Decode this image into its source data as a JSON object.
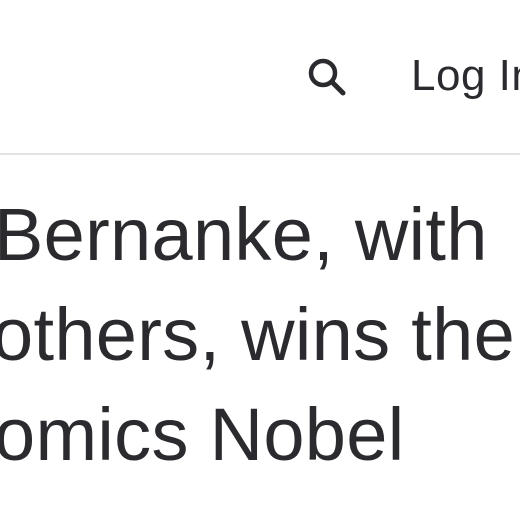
{
  "header": {
    "search_icon": "search-icon",
    "login_label": "Log In"
  },
  "article": {
    "title_lines": [
      "Bernanke, with",
      "others, wins the",
      "omics Nobel"
    ]
  },
  "colors": {
    "text": "#2b2b2f",
    "divider": "#e3e3e3",
    "background": "#ffffff"
  }
}
